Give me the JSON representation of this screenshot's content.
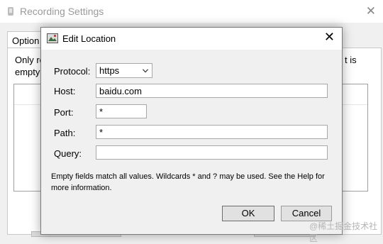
{
  "background_window": {
    "title": "Recording Settings",
    "tab_label": "Option",
    "text_left_line1": "Only re",
    "text_left_line2": "empty",
    "text_right_line1": "t is"
  },
  "dialog": {
    "title": "Edit Location",
    "fields": {
      "protocol_label": "Protocol:",
      "protocol_value": "https",
      "host_label": "Host:",
      "host_value": "baidu.com",
      "port_label": "Port:",
      "port_value": "*",
      "path_label": "Path:",
      "path_value": "*",
      "query_label": "Query:",
      "query_value": ""
    },
    "help_text": "Empty fields match all values. Wildcards * and ? may be used. See the Help for more information.",
    "ok_label": "OK",
    "cancel_label": "Cancel"
  },
  "watermark": "@稀土掘金技术社区",
  "icons": {
    "bg_title_icon": "app-icon",
    "dialog_icon": "edit-location-icon",
    "close": "close-icon",
    "dropdown": "chevron-down-icon"
  }
}
